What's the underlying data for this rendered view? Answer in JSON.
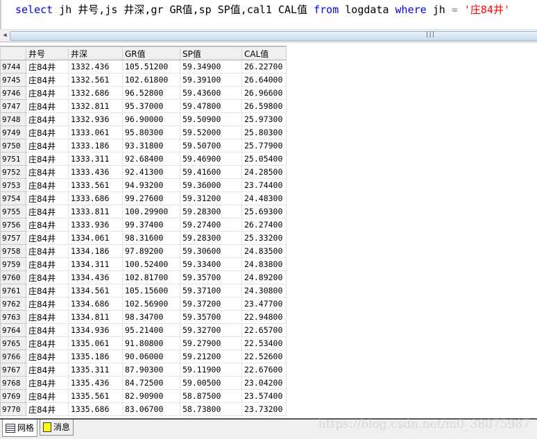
{
  "query": {
    "parts": [
      {
        "t": "select",
        "c": "kw"
      },
      {
        "t": " jh 井号,js 井深,gr GR值,sp SP值,cal1 CAL值 ",
        "c": ""
      },
      {
        "t": "from",
        "c": "kw"
      },
      {
        "t": " logdata ",
        "c": ""
      },
      {
        "t": "where",
        "c": "kw"
      },
      {
        "t": " jh ",
        "c": ""
      },
      {
        "t": "=",
        "c": "op"
      },
      {
        "t": " ",
        "c": ""
      },
      {
        "t": "'庄84井'",
        "c": "str"
      }
    ]
  },
  "grid": {
    "columns": [
      "井号",
      "井深",
      "GR值",
      "SP值",
      "CAL值"
    ],
    "rows": [
      [
        "9744",
        "庄84井",
        "1332.436",
        "105.51200",
        "59.34900",
        "26.22700"
      ],
      [
        "9745",
        "庄84井",
        "1332.561",
        "102.61800",
        "59.39100",
        "26.64000"
      ],
      [
        "9746",
        "庄84井",
        "1332.686",
        "96.52800",
        "59.43600",
        "26.96600"
      ],
      [
        "9747",
        "庄84井",
        "1332.811",
        "95.37000",
        "59.47800",
        "26.59800"
      ],
      [
        "9748",
        "庄84井",
        "1332.936",
        "96.90000",
        "59.50900",
        "25.97300"
      ],
      [
        "9749",
        "庄84井",
        "1333.061",
        "95.80300",
        "59.52000",
        "25.80300"
      ],
      [
        "9750",
        "庄84井",
        "1333.186",
        "93.31800",
        "59.50700",
        "25.77900"
      ],
      [
        "9751",
        "庄84井",
        "1333.311",
        "92.68400",
        "59.46900",
        "25.05400"
      ],
      [
        "9752",
        "庄84井",
        "1333.436",
        "92.41300",
        "59.41600",
        "24.28500"
      ],
      [
        "9753",
        "庄84井",
        "1333.561",
        "94.93200",
        "59.36000",
        "23.74400"
      ],
      [
        "9754",
        "庄84井",
        "1333.686",
        "99.27600",
        "59.31200",
        "24.48300"
      ],
      [
        "9755",
        "庄84井",
        "1333.811",
        "100.29900",
        "59.28300",
        "25.69300"
      ],
      [
        "9756",
        "庄84井",
        "1333.936",
        "99.37400",
        "59.27400",
        "26.27400"
      ],
      [
        "9757",
        "庄84井",
        "1334.061",
        "98.31600",
        "59.28300",
        "25.33200"
      ],
      [
        "9758",
        "庄84井",
        "1334.186",
        "97.89200",
        "59.30600",
        "24.83500"
      ],
      [
        "9759",
        "庄84井",
        "1334.311",
        "100.52400",
        "59.33400",
        "24.83800"
      ],
      [
        "9760",
        "庄84井",
        "1334.436",
        "102.81700",
        "59.35700",
        "24.89200"
      ],
      [
        "9761",
        "庄84井",
        "1334.561",
        "105.15600",
        "59.37100",
        "24.30800"
      ],
      [
        "9762",
        "庄84井",
        "1334.686",
        "102.56900",
        "59.37200",
        "23.47700"
      ],
      [
        "9763",
        "庄84井",
        "1334.811",
        "98.34700",
        "59.35700",
        "22.94800"
      ],
      [
        "9764",
        "庄84井",
        "1334.936",
        "95.21400",
        "59.32700",
        "22.65700"
      ],
      [
        "9765",
        "庄84井",
        "1335.061",
        "91.80800",
        "59.27900",
        "22.53400"
      ],
      [
        "9766",
        "庄84井",
        "1335.186",
        "90.06000",
        "59.21200",
        "22.52600"
      ],
      [
        "9767",
        "庄84井",
        "1335.311",
        "87.90300",
        "59.11900",
        "22.67600"
      ],
      [
        "9768",
        "庄84井",
        "1335.436",
        "84.72500",
        "59.00500",
        "23.04200"
      ],
      [
        "9769",
        "庄84井",
        "1335.561",
        "82.90900",
        "58.87500",
        "23.57400"
      ],
      [
        "9770",
        "庄84井",
        "1335.686",
        "83.06700",
        "58.73800",
        "23.73200"
      ]
    ]
  },
  "tabs": {
    "grid": "网格",
    "messages": "消息"
  },
  "watermark": "https://blog.csdn.net/m0_38075987"
}
